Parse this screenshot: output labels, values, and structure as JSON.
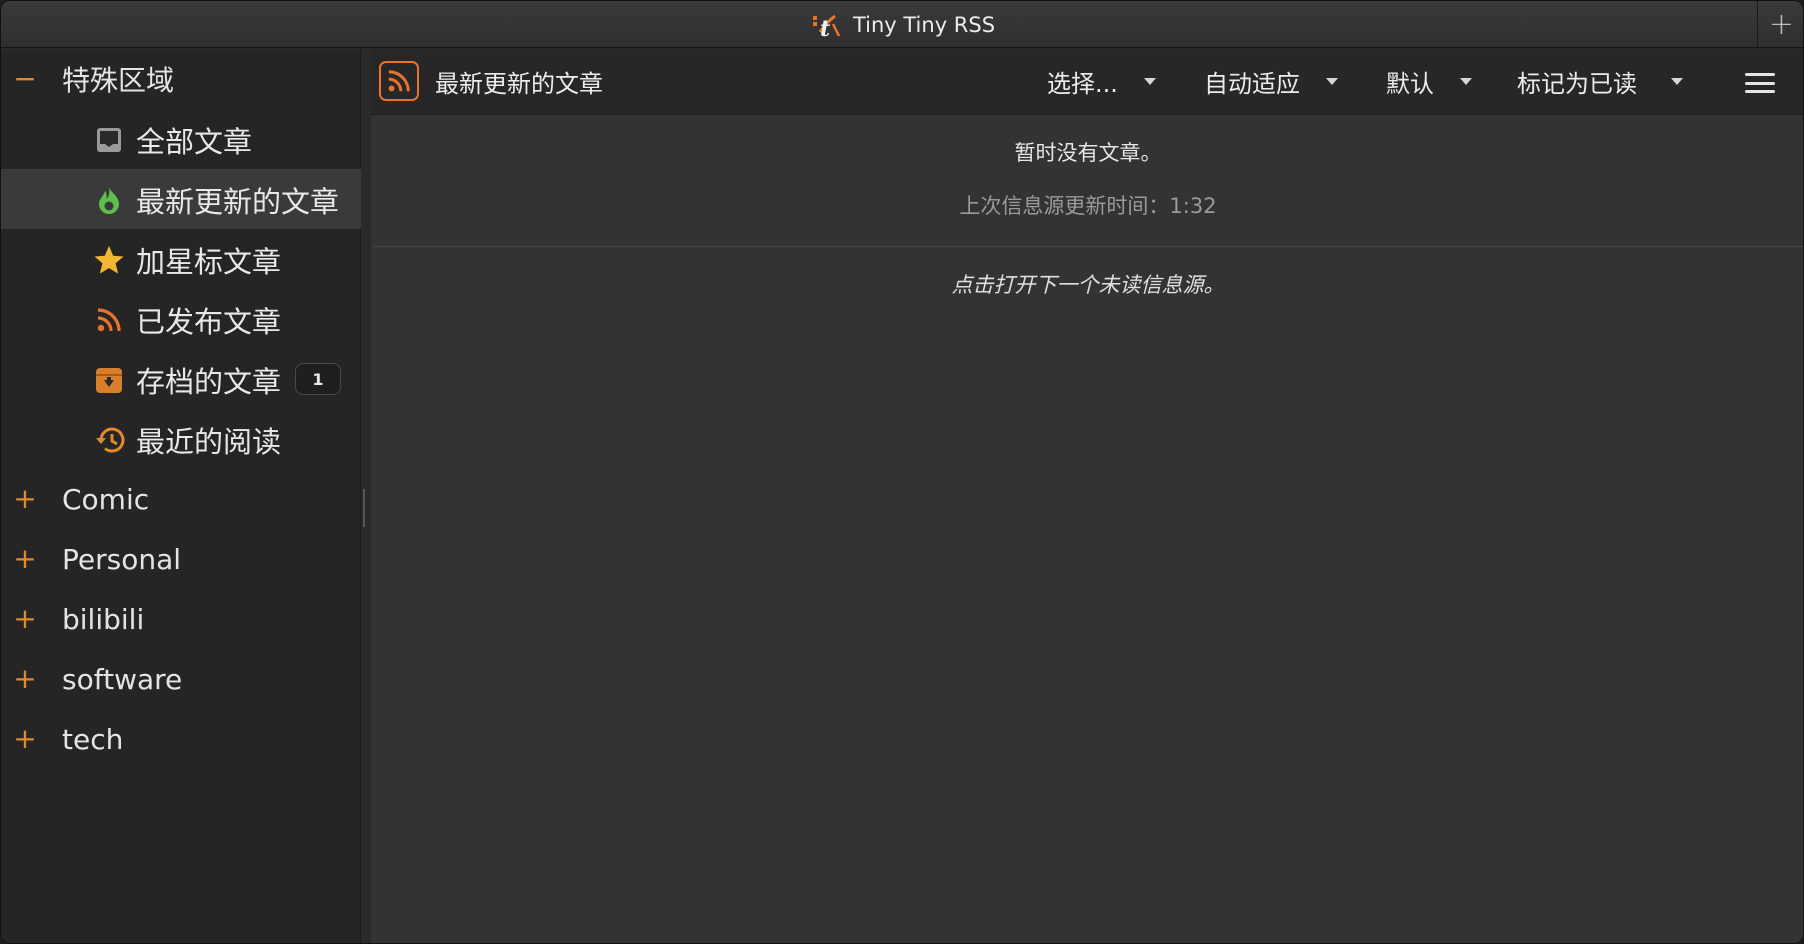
{
  "window": {
    "title": "Tiny Tiny RSS",
    "new_tab_icon": "plus-icon"
  },
  "colors": {
    "accent": "#e8742c",
    "fresh_green": "#5fbf4e",
    "star_yellow": "#f2b632",
    "archive_orange": "#d97f2c"
  },
  "sidebar": {
    "special": {
      "toggle": "−",
      "label": "特殊区域",
      "feeds": [
        {
          "label": "全部文章",
          "icon": "inbox-icon"
        },
        {
          "label": "最新更新的文章",
          "icon": "fresh-flame-icon",
          "active": true
        },
        {
          "label": "加星标文章",
          "icon": "star-icon"
        },
        {
          "label": "已发布文章",
          "icon": "rss-icon"
        },
        {
          "label": "存档的文章",
          "icon": "archive-icon",
          "counter": "1"
        },
        {
          "label": "最近的阅读",
          "icon": "history-icon"
        }
      ]
    },
    "categories": [
      {
        "toggle": "+",
        "label": "Comic"
      },
      {
        "toggle": "+",
        "label": "Personal"
      },
      {
        "toggle": "+",
        "label": "bilibili"
      },
      {
        "toggle": "+",
        "label": "software"
      },
      {
        "toggle": "+",
        "label": "tech"
      }
    ]
  },
  "toolbar": {
    "feed_title": "最新更新的文章",
    "select_label": "选择...",
    "view_mode_label": "自动适应",
    "order_label": "默认",
    "mark_read_label": "标记为已读"
  },
  "content": {
    "no_articles": "暂时没有文章。",
    "last_update": "上次信息源更新时间：1:32",
    "next_feed_hint": "点击打开下一个未读信息源。"
  }
}
